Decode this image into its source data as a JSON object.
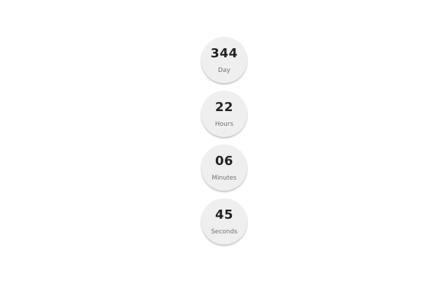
{
  "countdown": {
    "units": [
      {
        "value": "344",
        "label": "Day"
      },
      {
        "value": "22",
        "label": "Hours"
      },
      {
        "value": "06",
        "label": "Minutes"
      },
      {
        "value": "45",
        "label": "Seconds"
      }
    ]
  }
}
